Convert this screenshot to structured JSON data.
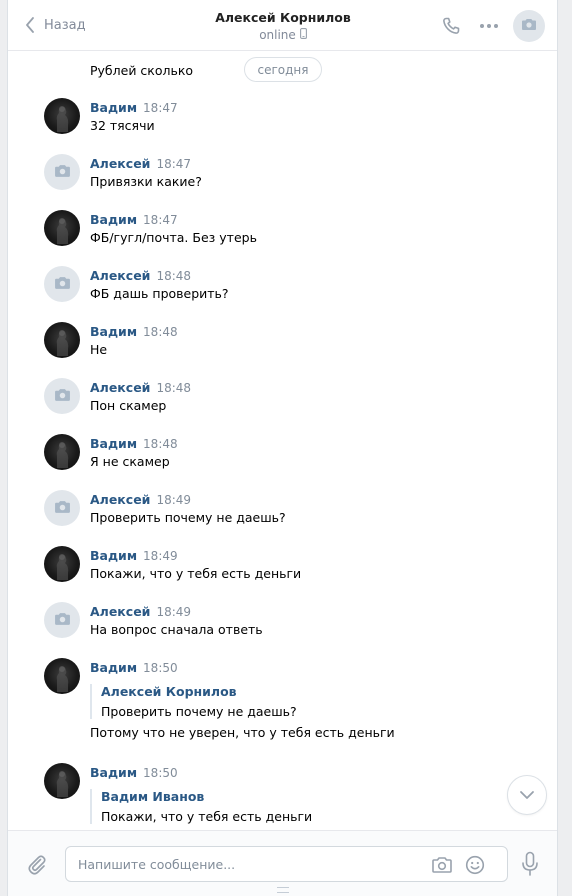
{
  "header": {
    "back_label": "Назад",
    "title": "Алексей Корнилов",
    "status": "online"
  },
  "date_separator": "сегодня",
  "top_partial_text": "Рублей сколько",
  "messages": [
    {
      "author": "Вадим",
      "time": "18:47",
      "text": "32 тясячи",
      "avatar": "dark"
    },
    {
      "author": "Алексей",
      "time": "18:47",
      "text": "Привязки какие?",
      "avatar": "grey"
    },
    {
      "author": "Вадим",
      "time": "18:47",
      "text": "ФБ/гугл/почта. Без утерь",
      "avatar": "dark"
    },
    {
      "author": "Алексей",
      "time": "18:48",
      "text": "ФБ дашь проверить?",
      "avatar": "grey"
    },
    {
      "author": "Вадим",
      "time": "18:48",
      "text": "Не",
      "avatar": "dark"
    },
    {
      "author": "Алексей",
      "time": "18:48",
      "text": "Пон скамер",
      "avatar": "grey"
    },
    {
      "author": "Вадим",
      "time": "18:48",
      "text": "Я не скамер",
      "avatar": "dark"
    },
    {
      "author": "Алексей",
      "time": "18:49",
      "text": "Проверить почему не даешь?",
      "avatar": "grey"
    },
    {
      "author": "Вадим",
      "time": "18:49",
      "text": "Покажи, что у тебя есть деньги",
      "avatar": "dark"
    },
    {
      "author": "Алексей",
      "time": "18:49",
      "text": "На вопрос сначала ответь",
      "avatar": "grey"
    },
    {
      "author": "Вадим",
      "time": "18:50",
      "forward_author": "Алексей Корнилов",
      "forward_text": "Проверить почему не даешь?",
      "text": "Потому что не уверен, что у тебя есть деньги",
      "avatar": "dark"
    },
    {
      "author": "Вадим",
      "time": "18:50",
      "forward_author": "Вадим Иванов",
      "forward_text": "Покажи, что у тебя есть деньги",
      "avatar": "dark"
    }
  ],
  "composer": {
    "placeholder": "Напишите сообщение..."
  },
  "icons": [
    "chevron-left-icon",
    "phone-icon",
    "more-icon",
    "camera-icon",
    "paperclip-icon",
    "smile-icon",
    "microphone-icon",
    "chevron-down-icon"
  ],
  "colors": {
    "link": "#2a5885",
    "muted": "#818c99",
    "bg": "#edeef0"
  }
}
